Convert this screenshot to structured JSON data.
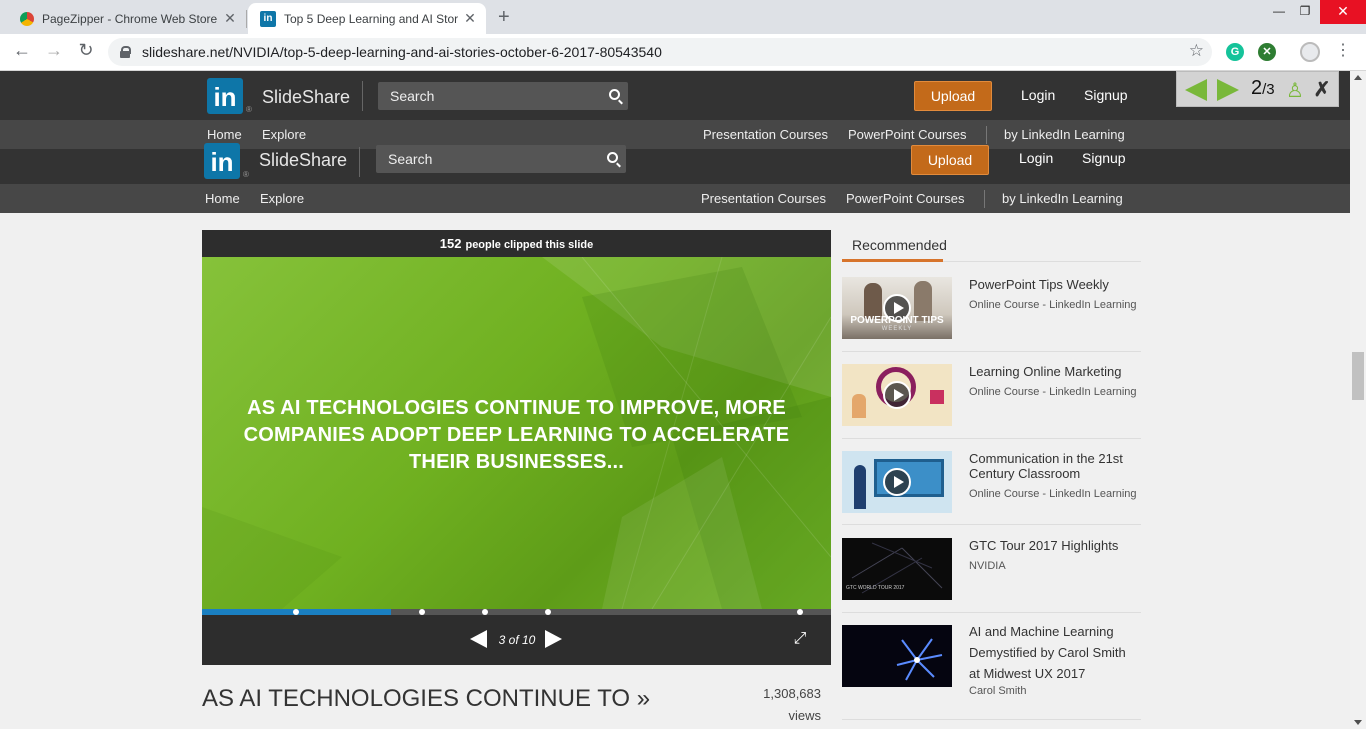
{
  "browser": {
    "tabs": [
      {
        "title": "PageZipper - Chrome Web Store",
        "active": false
      },
      {
        "title": "Top 5 Deep Learning and AI Stor",
        "active": true
      }
    ],
    "url": "slideshare.net/NVIDIA/top-5-deep-learning-and-ai-stories-october-6-2017-80543540",
    "extensions": [
      "grammarly-icon",
      "extension-x-icon"
    ]
  },
  "header": {
    "logo_mark": "in",
    "logo_reg": "®",
    "logo_text": "SlideShare",
    "search_placeholder": "Search",
    "upload_label": "Upload",
    "login_label": "Login",
    "signup_label": "Signup",
    "nav_home": "Home",
    "nav_explore": "Explore",
    "sub_links": [
      "Presentation Courses",
      "PowerPoint Courses",
      "by LinkedIn Learning"
    ]
  },
  "pagezipper": {
    "current": "2",
    "total": "/3"
  },
  "player": {
    "clip_count": "152",
    "clip_text": "people clipped this slide",
    "slide_text": "AS AI TECHNOLOGIES CONTINUE TO IMPROVE, MORE COMPANIES ADOPT DEEP LEARNING TO ACCELERATE THEIR BUSINESSES...",
    "page_counter": "3 of 10",
    "progress_fraction": 0.3,
    "accent": "#1a7fc1"
  },
  "slide_title": "AS AI TECHNOLOGIES CONTINUE TO »",
  "views": {
    "count": "1,308,683",
    "label": "views"
  },
  "recommended": {
    "heading": "Recommended",
    "items": [
      {
        "title": "PowerPoint Tips Weekly",
        "subtitle": "Online Course - LinkedIn Learning",
        "thumb_caption": "POWERPOINT TIPS",
        "thumb_caption2": "WEEKLY"
      },
      {
        "title": "Learning Online Marketing",
        "subtitle": "Online Course - LinkedIn Learning"
      },
      {
        "title": "Communication in the 21st Century Classroom",
        "subtitle": "Online Course - LinkedIn Learning"
      },
      {
        "title": "GTC Tour 2017 Highlights",
        "subtitle": "NVIDIA",
        "thumb_caption": "GTC WORLD TOUR 2017"
      },
      {
        "title": "AI and Machine Learning Demystified by Carol Smith at Midwest UX 2017",
        "subtitle": "Carol Smith"
      }
    ]
  },
  "colors": {
    "upload": "#c36a1a",
    "header_bg": "#333333",
    "subnav_bg": "#474747",
    "rec_accent": "#d7742b"
  }
}
